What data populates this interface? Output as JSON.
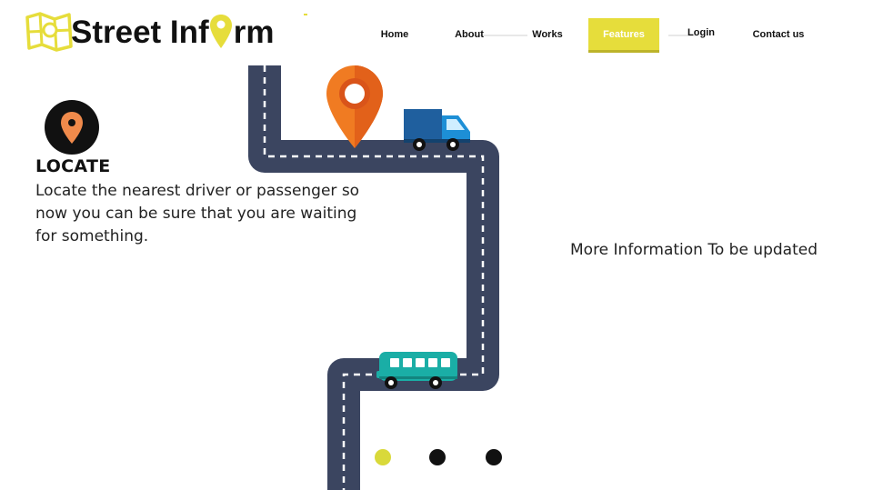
{
  "brand": {
    "name_part1": "Street Inf",
    "name_part2": "rm",
    "accent": "#e6dd3b"
  },
  "nav": {
    "items": [
      {
        "label": "Home"
      },
      {
        "label": "About"
      },
      {
        "label": "Works"
      },
      {
        "label": "Features",
        "active": true
      },
      {
        "label": "Login"
      },
      {
        "label": "Contact us"
      }
    ]
  },
  "feature": {
    "icon": "location-pin-icon",
    "title": "LOCATE",
    "description": "Locate the nearest driver or passenger so now you can be sure that you are waiting for something."
  },
  "more_info": "More Information To be updated",
  "carousel": {
    "slide_count": 3,
    "active_index": 0
  },
  "colors": {
    "road": "#3b4560",
    "pin_orange": "#f07b22",
    "truck_blue": "#1f5f9e",
    "bus_teal": "#1aaea6",
    "dot_active": "#d9d93a"
  }
}
